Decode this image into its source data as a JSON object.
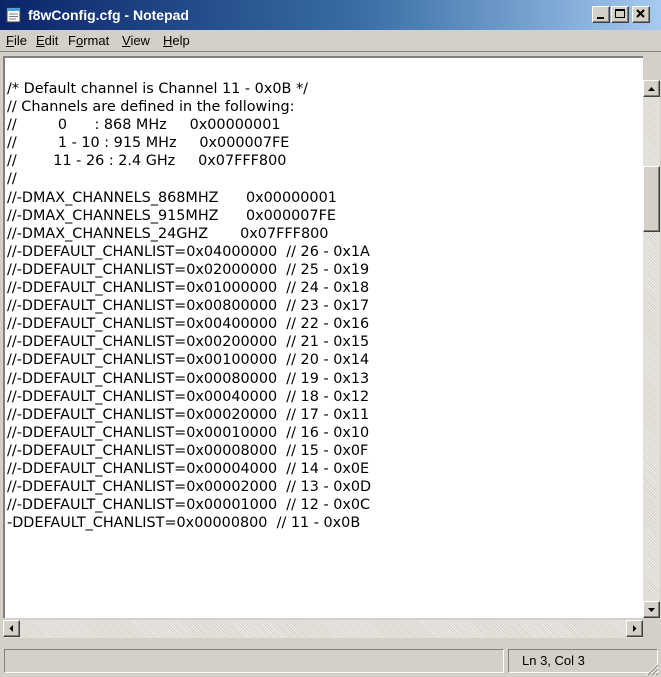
{
  "window": {
    "title": "f8wConfig.cfg - Notepad"
  },
  "menu": {
    "file": {
      "first": "F",
      "rest": "ile"
    },
    "edit": {
      "first": "E",
      "rest": "dit"
    },
    "format": {
      "first": "F",
      "o": "o",
      "rest": "rmat"
    },
    "view": {
      "first": "V",
      "rest": "iew"
    },
    "help": {
      "first": "H",
      "rest": "elp"
    }
  },
  "editor": {
    "lines": [
      "/* Default channel is Channel 11 - 0x0B */",
      "// Channels are defined in the following:",
      "//         0      : 868 MHz     0x00000001",
      "//         1 - 10 : 915 MHz     0x000007FE",
      "//        11 - 26 : 2.4 GHz     0x07FFF800",
      "//",
      "//-DMAX_CHANNELS_868MHZ      0x00000001",
      "//-DMAX_CHANNELS_915MHZ      0x000007FE",
      "//-DMAX_CHANNELS_24GHZ       0x07FFF800",
      "//-DDEFAULT_CHANLIST=0x04000000  // 26 - 0x1A",
      "//-DDEFAULT_CHANLIST=0x02000000  // 25 - 0x19",
      "//-DDEFAULT_CHANLIST=0x01000000  // 24 - 0x18",
      "//-DDEFAULT_CHANLIST=0x00800000  // 23 - 0x17",
      "//-DDEFAULT_CHANLIST=0x00400000  // 22 - 0x16",
      "//-DDEFAULT_CHANLIST=0x00200000  // 21 - 0x15",
      "//-DDEFAULT_CHANLIST=0x00100000  // 20 - 0x14",
      "//-DDEFAULT_CHANLIST=0x00080000  // 19 - 0x13",
      "//-DDEFAULT_CHANLIST=0x00040000  // 18 - 0x12",
      "//-DDEFAULT_CHANLIST=0x00020000  // 17 - 0x11",
      "//-DDEFAULT_CHANLIST=0x00010000  // 16 - 0x10",
      "//-DDEFAULT_CHANLIST=0x00008000  // 15 - 0x0F",
      "//-DDEFAULT_CHANLIST=0x00004000  // 14 - 0x0E",
      "//-DDEFAULT_CHANLIST=0x00002000  // 13 - 0x0D",
      "//-DDEFAULT_CHANLIST=0x00001000  // 12 - 0x0C",
      "-DDEFAULT_CHANLIST=0x00000800  // 11 - 0x0B"
    ]
  },
  "status": {
    "position": "Ln 3, Col 3"
  },
  "icons": {
    "app": "notepad-icon",
    "minimize": "minimize-icon",
    "maximize": "maximize-icon",
    "close": "close-icon"
  },
  "colors": {
    "titlebar_start": "#0a246a",
    "titlebar_end": "#a6caf0",
    "chrome": "#d4d0c8"
  }
}
